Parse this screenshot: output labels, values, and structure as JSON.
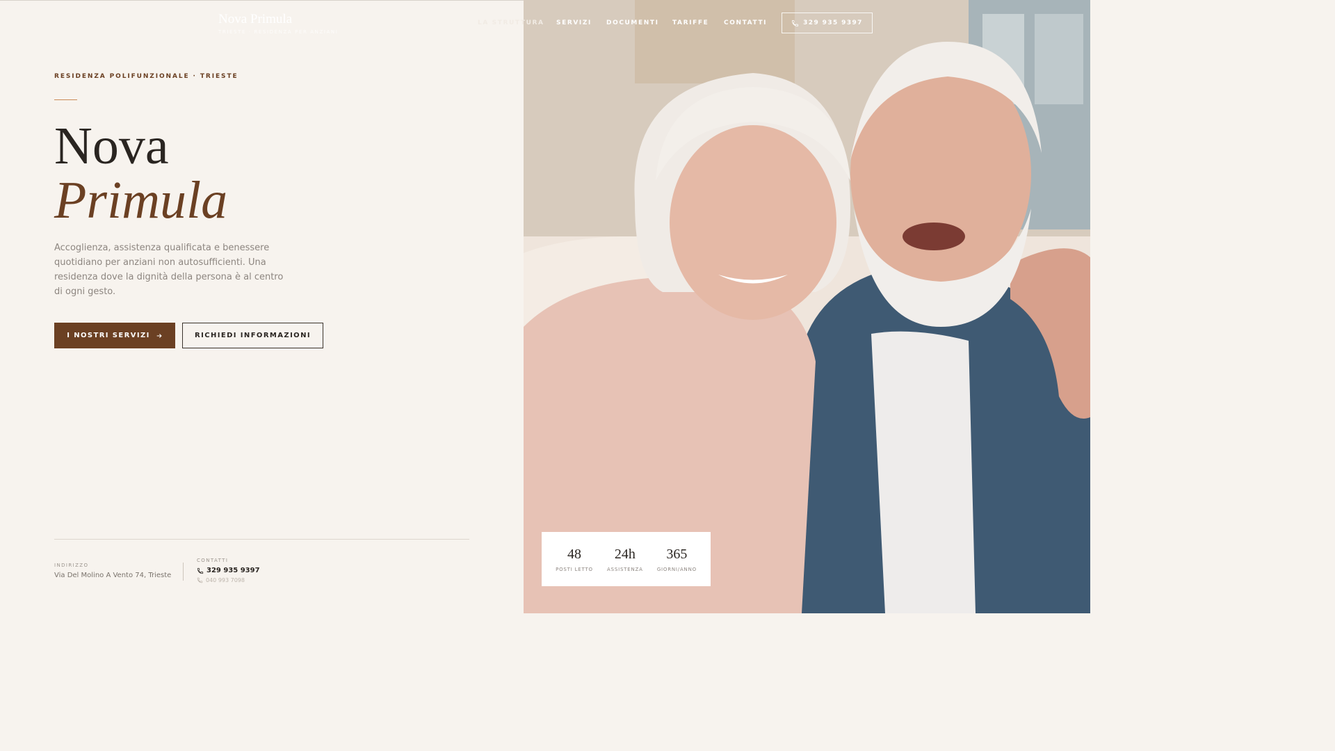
{
  "brand": {
    "name": "Nova Primula",
    "tagline": "TRIESTE · RESIDENZA PER ANZIANI"
  },
  "nav": {
    "items": [
      "LA STRUTTURA",
      "SERVIZI",
      "DOCUMENTI",
      "TARIFFE",
      "CONTATTI"
    ],
    "phone": "329 935 9397"
  },
  "hero": {
    "eyebrow": "RESIDENZA POLIFUNZIONALE · TRIESTE",
    "title_line1": "Nova",
    "title_line2": "Primula",
    "lead": "Accoglienza, assistenza qualificata e benessere quotidiano per anziani non autosufficienti. Una residenza dove la dignità della persona è al centro di ogni gesto.",
    "primary_button": "I NOSTRI SERVIZI",
    "secondary_button": "RICHIEDI INFORMAZIONI"
  },
  "footer_info": {
    "address_label": "INDIRIZZO",
    "address_value": "Via Del Molino A Vento 74, Trieste",
    "contact_label": "CONTATTI",
    "contact_main": "329 935 9397",
    "contact_sub": "040 993 7098"
  },
  "stats": [
    {
      "value": "48",
      "label": "POSTI LETTO"
    },
    {
      "value": "24h",
      "label": "ASSISTENZA"
    },
    {
      "value": "365",
      "label": "GIORNI/ANNO"
    }
  ],
  "colors": {
    "accent_brown": "#6b4023",
    "accent_line": "#c98a55",
    "background": "#f7f3ee"
  },
  "icons": {
    "phone": "phone-icon",
    "arrow": "arrow-right-icon"
  }
}
